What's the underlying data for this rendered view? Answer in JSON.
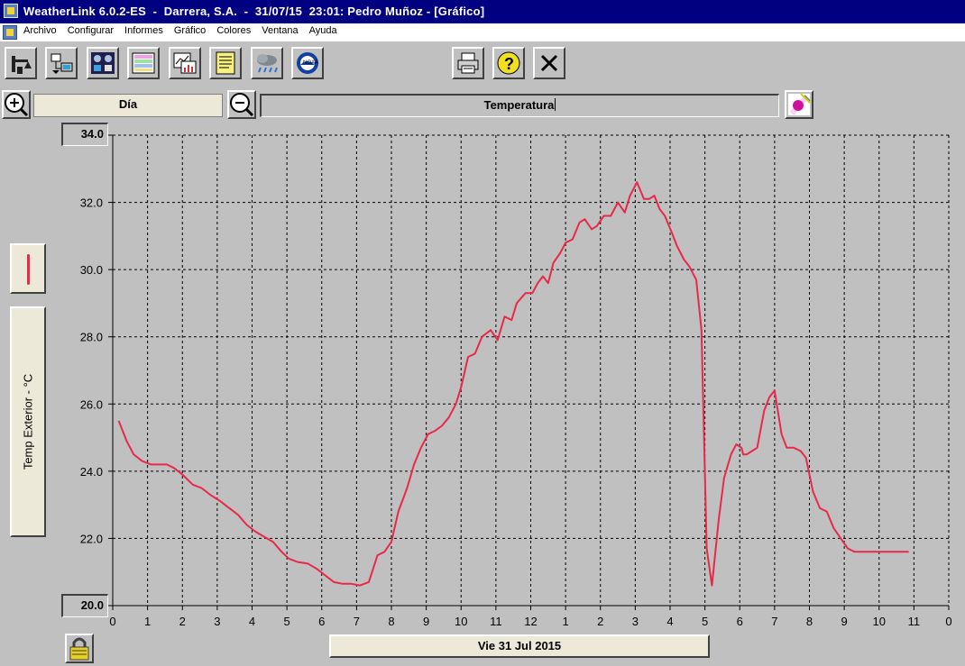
{
  "window": {
    "title": "WeatherLink 6.0.2-ES  -  Darrera, S.A.  -  31/07/15  23:01: Pedro Muñoz - [Gráfico]"
  },
  "menu": [
    "Archivo",
    "Configurar",
    "Informes",
    "Gráfico",
    "Colores",
    "Ventana",
    "Ayuda"
  ],
  "toolbar": {
    "icons": [
      "walk-station-icon",
      "download-icon",
      "bulletin-icon",
      "strip-chart-icon",
      "graph-icon",
      "browse-icon",
      "weather-icon",
      "noaa-icon",
      "print-icon",
      "help-icon",
      "close-icon"
    ]
  },
  "range": {
    "label": "Día"
  },
  "sensor": {
    "label": "Temperatura"
  },
  "series": {
    "name": "Temp Exterior - °C",
    "color": "#e8294a"
  },
  "axis": {
    "top_value": "34.0",
    "bottom_value": "20.0"
  },
  "date": {
    "label": "Vie 31 Jul 2015"
  },
  "chart_data": {
    "type": "line",
    "ylabel": "Temp Exterior - °C",
    "ylim": [
      20,
      34
    ],
    "xlim": [
      0,
      24
    ],
    "x_tick_labels": [
      "0",
      "1",
      "2",
      "3",
      "4",
      "5",
      "6",
      "7",
      "8",
      "9",
      "10",
      "11",
      "12",
      "1",
      "2",
      "3",
      "4",
      "5",
      "6",
      "7",
      "8",
      "9",
      "10",
      "11",
      "0"
    ],
    "y_tick_labels": [
      "20.0",
      "22.0",
      "24.0",
      "26.0",
      "28.0",
      "30.0",
      "32.0",
      "34.0"
    ],
    "grid": true,
    "series": [
      {
        "name": "Temp Exterior - °C",
        "color": "#e8294a",
        "x": [
          0.17,
          0.4,
          0.6,
          0.85,
          1.1,
          1.3,
          1.55,
          1.75,
          2.0,
          2.3,
          2.55,
          2.8,
          3.1,
          3.35,
          3.6,
          3.85,
          4.1,
          4.35,
          4.6,
          4.85,
          5.05,
          5.3,
          5.6,
          5.85,
          6.1,
          6.35,
          6.6,
          6.85,
          7.1,
          7.35,
          7.6,
          7.8,
          8.0,
          8.2,
          8.45,
          8.65,
          8.85,
          9.05,
          9.25,
          9.45,
          9.65,
          9.85,
          10.0,
          10.2,
          10.4,
          10.6,
          10.85,
          11.05,
          11.25,
          11.45,
          11.6,
          11.85,
          12.05,
          12.2,
          12.35,
          12.5,
          12.65,
          12.85,
          13.0,
          13.2,
          13.4,
          13.55,
          13.75,
          13.9,
          14.1,
          14.3,
          14.5,
          14.7,
          14.85,
          15.05,
          15.25,
          15.4,
          15.55,
          15.7,
          15.85,
          16.05,
          16.2,
          16.4,
          16.55,
          16.75,
          16.9,
          17.05,
          17.2,
          17.4,
          17.55,
          17.75,
          17.9,
          18.05,
          18.1,
          18.2,
          18.35,
          18.5,
          18.7,
          18.85,
          19.0,
          19.2,
          19.35,
          19.55,
          19.75,
          19.9,
          20.1,
          20.3,
          20.5,
          20.7,
          20.9,
          21.1,
          21.3,
          21.5,
          21.65,
          21.85,
          22.05,
          22.25,
          22.45,
          22.65,
          22.85
        ],
        "y": [
          25.5,
          24.9,
          24.5,
          24.3,
          24.2,
          24.2,
          24.2,
          24.1,
          23.9,
          23.6,
          23.5,
          23.3,
          23.1,
          22.9,
          22.7,
          22.4,
          22.2,
          22.05,
          21.9,
          21.6,
          21.4,
          21.3,
          21.25,
          21.1,
          20.9,
          20.7,
          20.65,
          20.65,
          20.6,
          20.7,
          21.5,
          21.6,
          21.9,
          22.8,
          23.5,
          24.2,
          24.7,
          25.1,
          25.2,
          25.35,
          25.6,
          26.0,
          26.5,
          27.4,
          27.5,
          28.0,
          28.2,
          27.9,
          28.6,
          28.5,
          29.0,
          29.3,
          29.3,
          29.6,
          29.8,
          29.6,
          30.2,
          30.5,
          30.8,
          30.9,
          31.4,
          31.5,
          31.2,
          31.3,
          31.6,
          31.6,
          32.0,
          31.7,
          32.2,
          32.6,
          32.1,
          32.1,
          32.2,
          31.8,
          31.6,
          31.1,
          30.7,
          30.3,
          30.1,
          29.7,
          28.2,
          21.7,
          20.6,
          22.6,
          23.8,
          24.5,
          24.8,
          24.7,
          24.5,
          24.5,
          24.6,
          24.7,
          25.8,
          26.2,
          26.4,
          25.1,
          24.7,
          24.7,
          24.6,
          24.4,
          23.4,
          22.9,
          22.8,
          22.3,
          22.0,
          21.7,
          21.6,
          21.6,
          21.6,
          21.6,
          21.6,
          21.6,
          21.6,
          21.6,
          21.6
        ]
      }
    ]
  }
}
